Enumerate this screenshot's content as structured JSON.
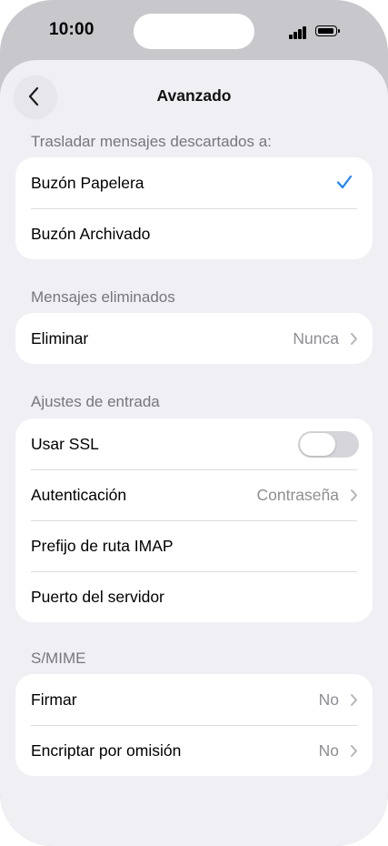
{
  "status_bar": {
    "time": "10:00"
  },
  "nav": {
    "title": "Avanzado",
    "back_icon": "chevron-left-icon"
  },
  "sections": {
    "discarded": {
      "header": "Trasladar mensajes descartados a:",
      "items": [
        {
          "label": "Buzón Papelera",
          "selected": true
        },
        {
          "label": "Buzón Archivado",
          "selected": false
        }
      ]
    },
    "deleted": {
      "header": "Mensajes eliminados",
      "items": [
        {
          "label": "Eliminar",
          "value": "Nunca"
        }
      ]
    },
    "incoming": {
      "header": "Ajustes de entrada",
      "items": [
        {
          "label": "Usar SSL",
          "toggle_on": false
        },
        {
          "label": "Autenticación",
          "value": "Contraseña"
        },
        {
          "label": "Prefijo de ruta IMAP"
        },
        {
          "label": "Puerto del servidor"
        }
      ]
    },
    "smime": {
      "header": "S/MIME",
      "items": [
        {
          "label": "Firmar",
          "value": "No"
        },
        {
          "label": "Encriptar por omisión",
          "value": "No"
        }
      ]
    }
  },
  "colors": {
    "accent": "#1a85ff",
    "background": "#f0eff4",
    "secondary_text": "#8e8d93"
  }
}
